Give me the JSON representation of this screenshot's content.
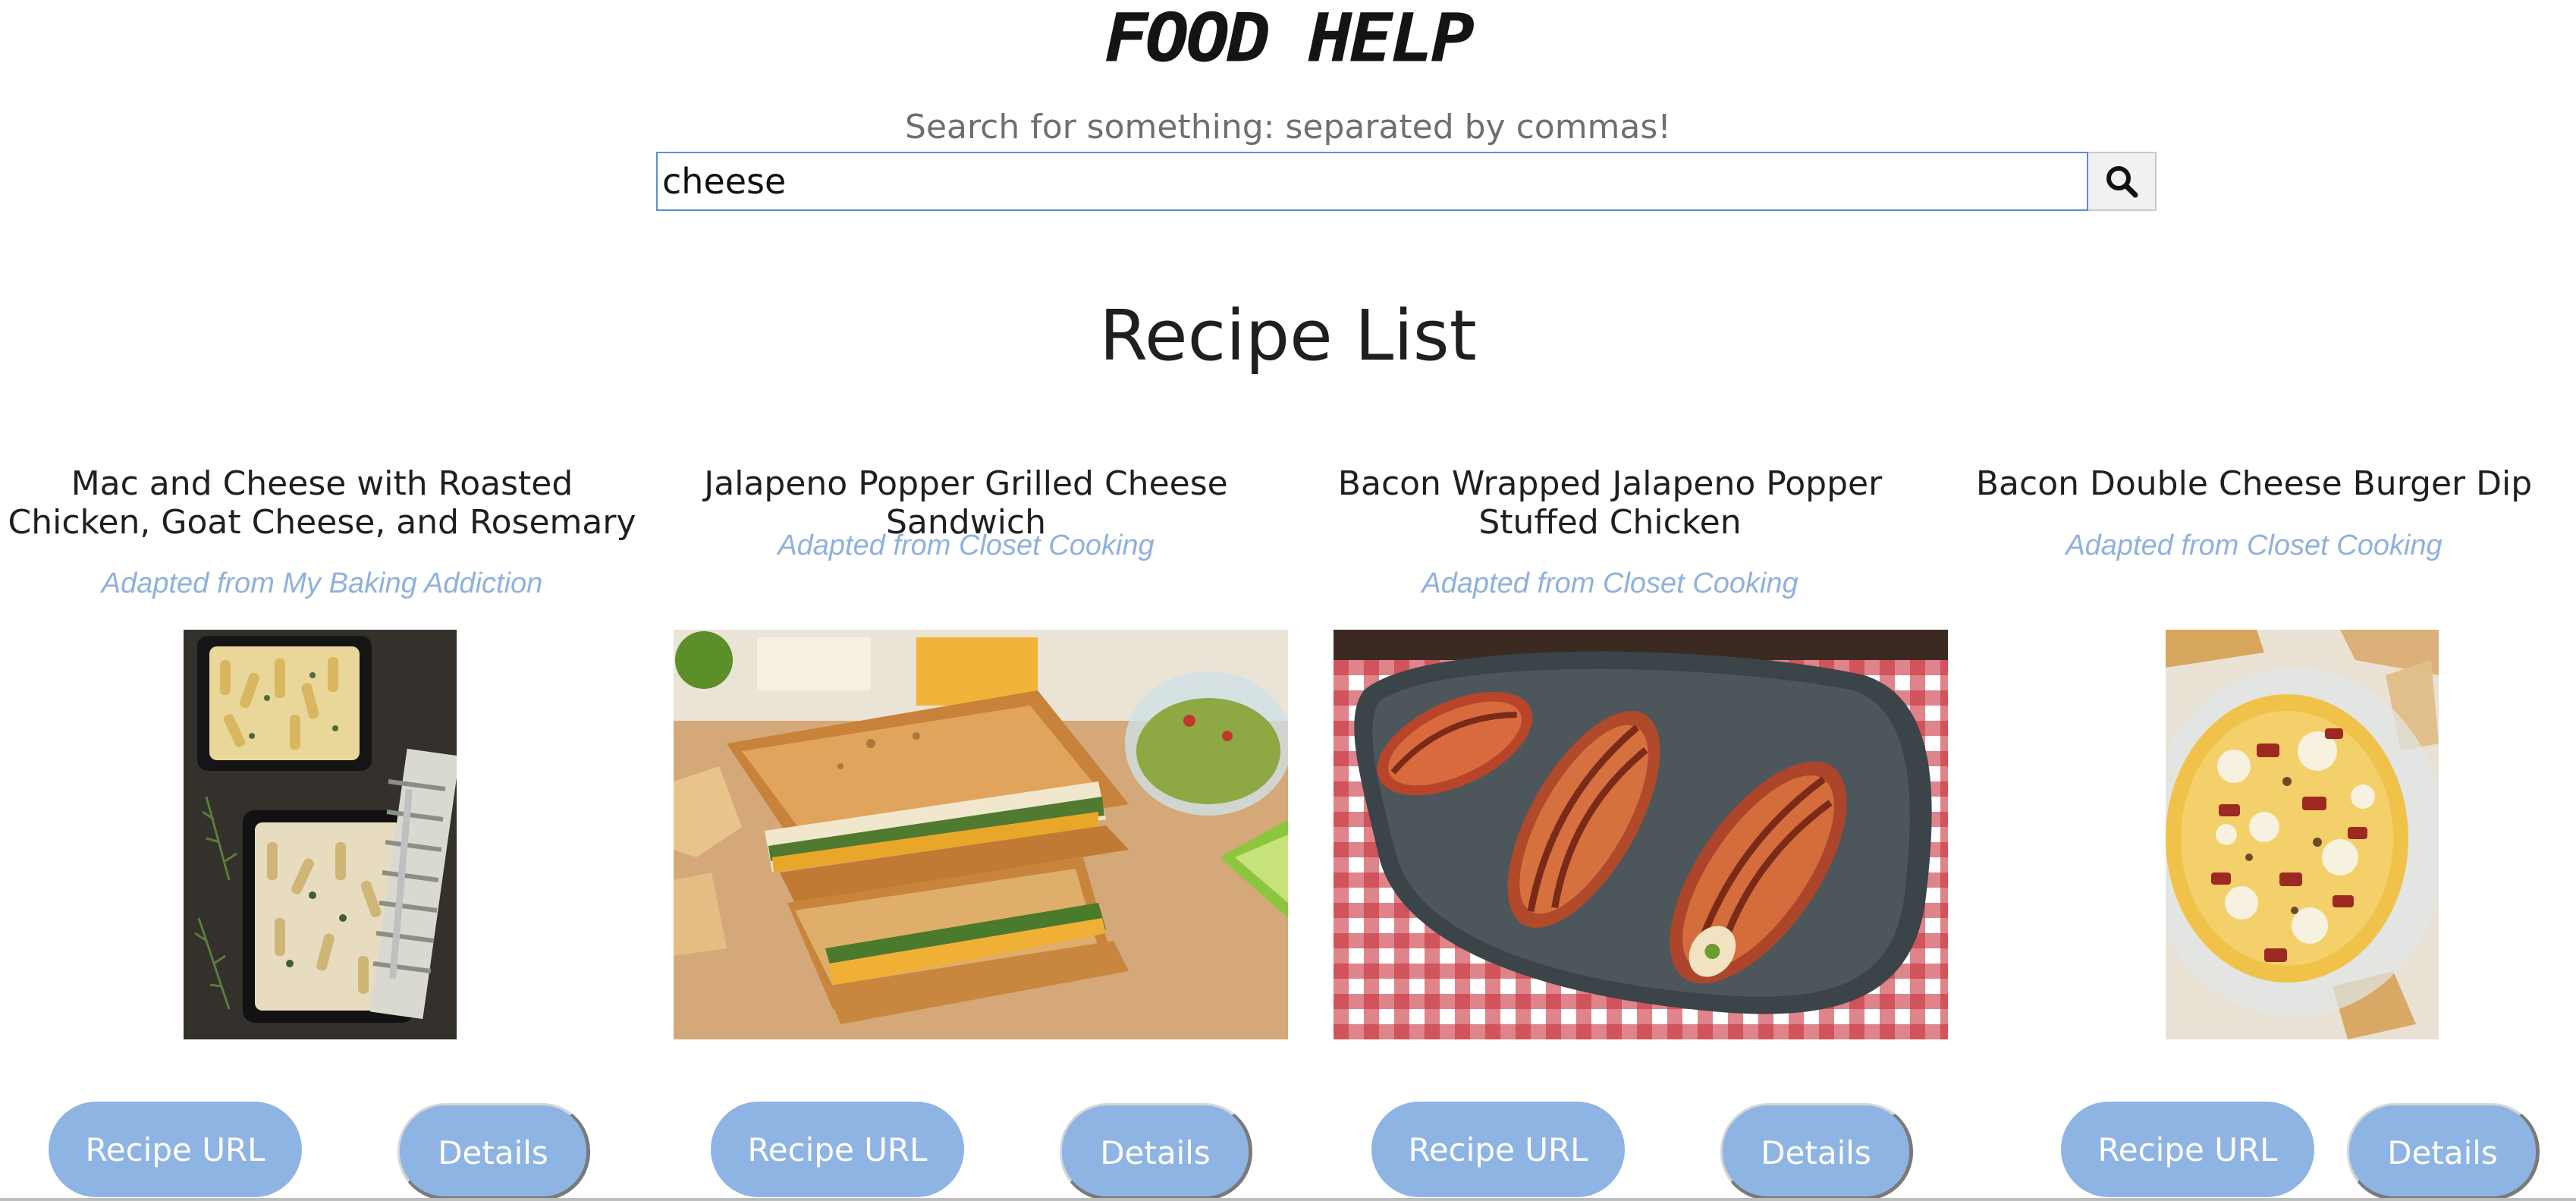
{
  "header": {
    "logo": "FOOD HELP",
    "search_prompt": "Search for something: separated by commas!"
  },
  "search": {
    "value": "cheese",
    "button_icon": "magnifier-icon"
  },
  "main": {
    "title": "Recipe List"
  },
  "recipes": [
    {
      "title": "Mac and Cheese with Roasted Chicken, Goat Cheese, and Rosemary",
      "source": "Adapted from My Baking Addiction",
      "image": "mac-and-cheese-photo",
      "url_button": "Recipe URL",
      "details_button": "Details"
    },
    {
      "title": "Jalapeno Popper Grilled Cheese Sandwich",
      "source": "Adapted from Closet Cooking",
      "image": "grilled-cheese-photo",
      "url_button": "Recipe URL",
      "details_button": "Details"
    },
    {
      "title": "Bacon Wrapped Jalapeno Popper Stuffed Chicken",
      "source": "Adapted from Closet Cooking",
      "image": "bacon-wrapped-chicken-photo",
      "url_button": "Recipe URL",
      "details_button": "Details"
    },
    {
      "title": "Bacon Double Cheese Burger Dip",
      "source": "Adapted from Closet Cooking",
      "image": "burger-dip-photo",
      "url_button": "Recipe URL",
      "details_button": "Details"
    }
  ],
  "colors": {
    "accent": "#8eb4e3",
    "source_text": "#8fb1dd",
    "search_border": "#5b8fd6"
  }
}
